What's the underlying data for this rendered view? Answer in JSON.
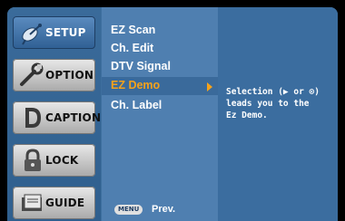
{
  "sidebar": {
    "items": [
      {
        "label": "SETUP",
        "icon": "satellite-dish-icon",
        "active": true
      },
      {
        "label": "OPTION",
        "icon": "wrench-icon",
        "active": false
      },
      {
        "label": "CAPTION",
        "icon": "caption-d-icon",
        "active": false
      },
      {
        "label": "LOCK",
        "icon": "padlock-icon",
        "active": false
      },
      {
        "label": "GUIDE",
        "icon": "guide-book-icon",
        "active": false
      }
    ]
  },
  "menu": {
    "items": [
      {
        "label": "EZ Scan"
      },
      {
        "label": "Ch. Edit"
      },
      {
        "label": "DTV Signal"
      },
      {
        "label": "EZ Demo",
        "selected": true
      },
      {
        "label": "Ch. Label"
      }
    ]
  },
  "description": {
    "text": "Selection (▶ or ⊙)\nleads you to the\nEz Demo."
  },
  "footer": {
    "menu_key": "MENU",
    "prev_label": "Prev."
  },
  "colors": {
    "selected_text": "#f6a21a",
    "panel_blue": "#4f7fb0",
    "description_blue": "#3b6d9f"
  }
}
